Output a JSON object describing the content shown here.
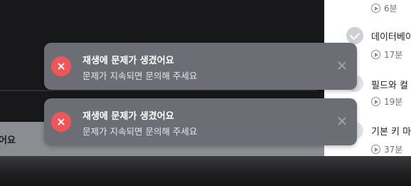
{
  "player": {
    "caption": "어요"
  },
  "curriculum": {
    "items": [
      {
        "title": "",
        "duration": "6분"
      },
      {
        "title": "데이터베이",
        "duration": "17분"
      },
      {
        "title": "필드와 컬",
        "duration": "19분"
      },
      {
        "title": "기본 키 마",
        "duration": "37분"
      }
    ]
  },
  "toasts": [
    {
      "title": "재생에 문제가 생겼어요",
      "message": "문제가 지속되면 문의해 주세요",
      "icon": "error-x-icon",
      "icon_color": "#f25557"
    },
    {
      "title": "재생에 문제가 생겼어요",
      "message": "문제가 지속되면 문의해 주세요",
      "icon": "error-x-icon",
      "icon_color": "#f25557"
    }
  ]
}
